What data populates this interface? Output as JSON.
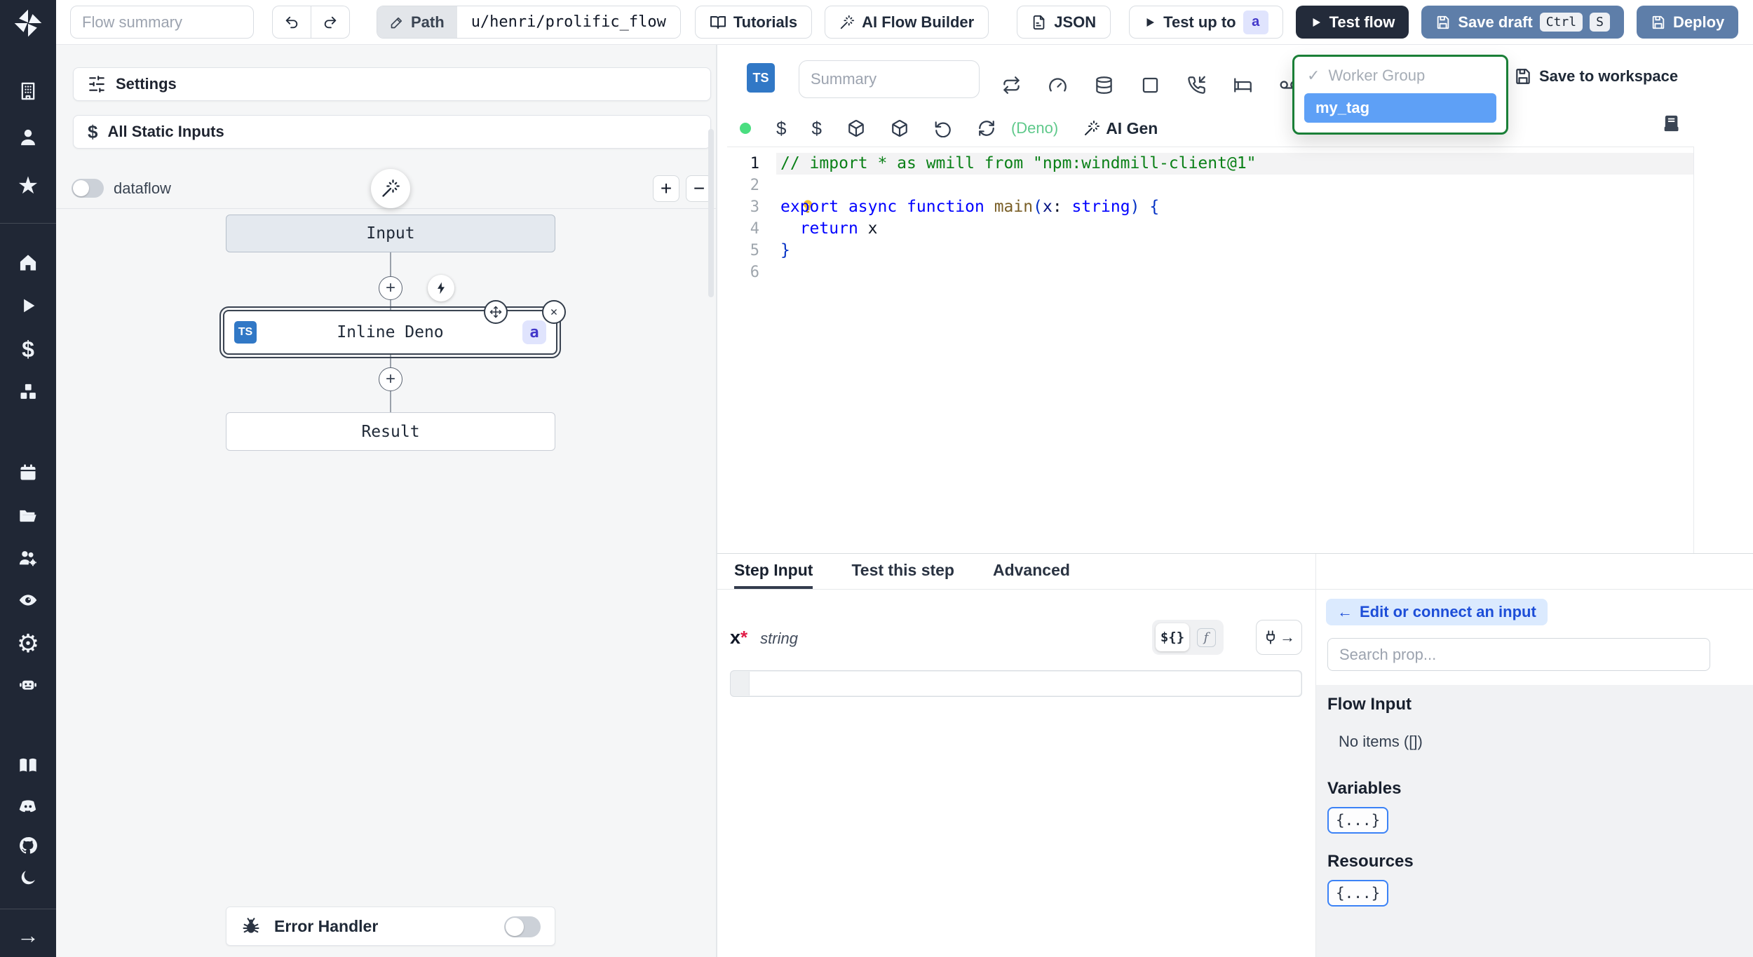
{
  "colors": {
    "steel_blue": "#5e7ea9",
    "dark_navy": "#232b3a",
    "green_border": "#1a7f37",
    "tag_selected_bg": "#5ea0f6",
    "badge_bg": "#e0e4fd",
    "badge_text": "#4338ca",
    "ts_blue": "#3178c6",
    "green_dot": "#4ade80",
    "deno_green": "#5fc98b",
    "pill_bg": "#dbeafe",
    "pill_text": "#1d4ed8",
    "focus_blue": "#3b82f6"
  },
  "glyphs": {
    "check": "✓",
    "close": "✕",
    "arrow_left": "←",
    "arrow_right": "→",
    "plus": "+",
    "minus": "−",
    "gear": "⚙",
    "star": "★",
    "play": "▶",
    "moon": "☾",
    "dollar": "$"
  },
  "topbar": {
    "flow_summary_placeholder": "Flow summary",
    "path_label": "Path",
    "path_value": "u/henri/prolific_flow",
    "tutorials_label": "Tutorials",
    "ai_flow_builder_label": "AI Flow Builder",
    "json_label": "JSON",
    "test_up_to_label": "Test up to",
    "test_up_to_badge": "a",
    "test_flow_label": "Test flow",
    "save_draft_label": "Save draft",
    "save_draft_kbd": [
      "Ctrl",
      "S"
    ],
    "deploy_label": "Deploy"
  },
  "sidebar": {
    "icons": [
      "windmill-logo",
      "building",
      "person",
      "star",
      "home",
      "play",
      "dollar",
      "cubes",
      "calendar",
      "folder",
      "user-group",
      "eye",
      "gear",
      "robot",
      "book",
      "discord",
      "github",
      "moon",
      "expand-arrow"
    ]
  },
  "flow_panel": {
    "settings_label": "Settings",
    "all_static_inputs_label": "All Static Inputs",
    "dataflow_label": "dataflow",
    "nodes": {
      "input_label": "Input",
      "step_lang": "TS",
      "step_label": "Inline Deno",
      "step_badge": "a",
      "result_label": "Result"
    },
    "error_handler_label": "Error Handler"
  },
  "editor": {
    "lang_badge": "TS",
    "summary_placeholder": "Summary",
    "deno_label": "(Deno)",
    "ai_gen_label": "AI Gen",
    "save_to_workspace_label": "Save to workspace",
    "dropdown": {
      "group_label": "Worker Group",
      "selected_option": "my_tag"
    },
    "code": {
      "lines": [
        {
          "n": 1,
          "active": true,
          "tokens": [
            [
              "c",
              "// import * as wmill from \"npm:windmill-client@1\""
            ]
          ]
        },
        {
          "n": 2,
          "active": false,
          "tokens": [
            [
              "bulb",
              ""
            ]
          ]
        },
        {
          "n": 3,
          "active": false,
          "tokens": [
            [
              "k",
              "export"
            ],
            [
              "p",
              " "
            ],
            [
              "k",
              "async"
            ],
            [
              "p",
              " "
            ],
            [
              "k",
              "function"
            ],
            [
              "p",
              " "
            ],
            [
              "f",
              "main"
            ],
            [
              "b",
              "("
            ],
            [
              "v",
              "x"
            ],
            [
              "p",
              ": "
            ],
            [
              "t",
              "string"
            ],
            [
              "b",
              ")"
            ],
            [
              "p",
              " "
            ],
            [
              "b",
              "{"
            ]
          ]
        },
        {
          "n": 4,
          "active": false,
          "tokens": [
            [
              "p",
              "  "
            ],
            [
              "k",
              "return"
            ],
            [
              "p",
              " x"
            ]
          ]
        },
        {
          "n": 5,
          "active": false,
          "tokens": [
            [
              "b",
              "}"
            ]
          ]
        },
        {
          "n": 6,
          "active": false,
          "tokens": []
        }
      ]
    }
  },
  "bottom_panel": {
    "tabs": [
      "Step Input",
      "Test this step",
      "Advanced"
    ],
    "arg": {
      "name": "x",
      "required_mark": "*",
      "type": "string"
    },
    "expr_toggle_label": "${}",
    "fn_toggle_label": "f",
    "connect_pill_label": "Edit or connect an input",
    "search_placeholder": "Search prop...",
    "flow_input_title": "Flow Input",
    "flow_input_empty": "No items ([])",
    "variables_title": "Variables",
    "variables_badge": "{...}",
    "resources_title": "Resources",
    "resources_badge": "{...}"
  }
}
